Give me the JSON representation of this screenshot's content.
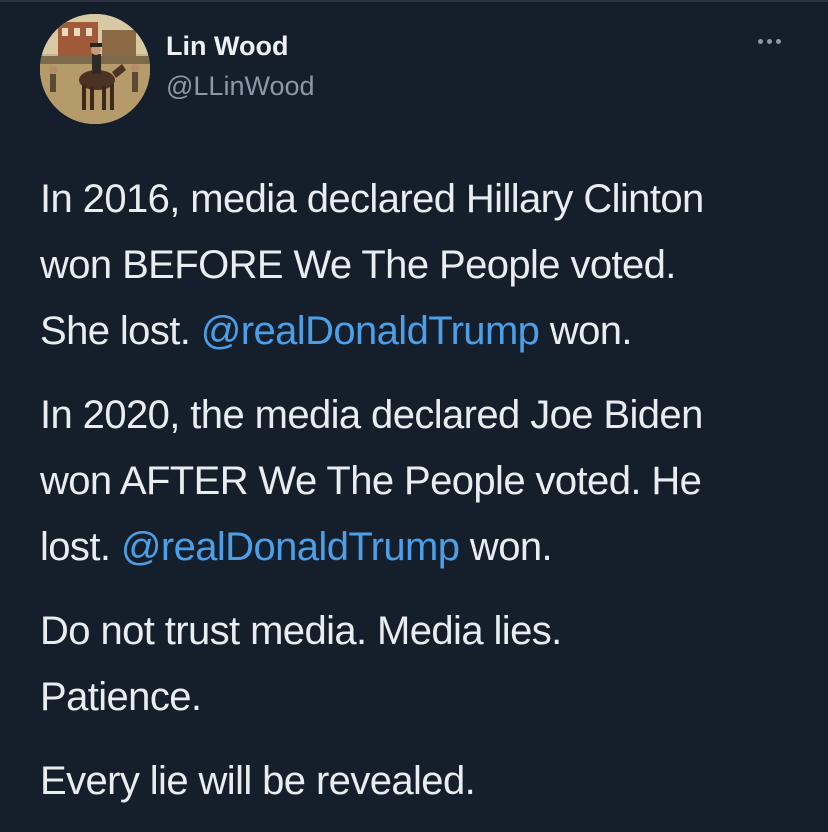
{
  "author": {
    "name": "Lin Wood",
    "handle": "@LLinWood"
  },
  "icons": {
    "more": "more-horizontal-icon",
    "avatar": "avatar-painting-horse-rider"
  },
  "colors": {
    "background": "#151f2c",
    "text": "#e9edf0",
    "secondary_text": "#8b98a5",
    "mention": "#4a9fe8"
  },
  "tweet": {
    "p1": {
      "line1": "In 2016, media declared Hillary Clinton",
      "line2": "won BEFORE We The People voted.",
      "pre": "She lost. ",
      "mention": "@realDonaldTrump",
      "post": " won."
    },
    "p2": {
      "line1": "In 2020, the media declared Joe Biden",
      "line2": "won AFTER We The People voted. He",
      "pre": "lost. ",
      "mention": "@realDonaldTrump",
      "post": " won."
    },
    "p3": {
      "line1": "Do not trust media. Media lies.",
      "line2": "Patience."
    },
    "p4": {
      "line1": "Every lie will be revealed."
    }
  }
}
